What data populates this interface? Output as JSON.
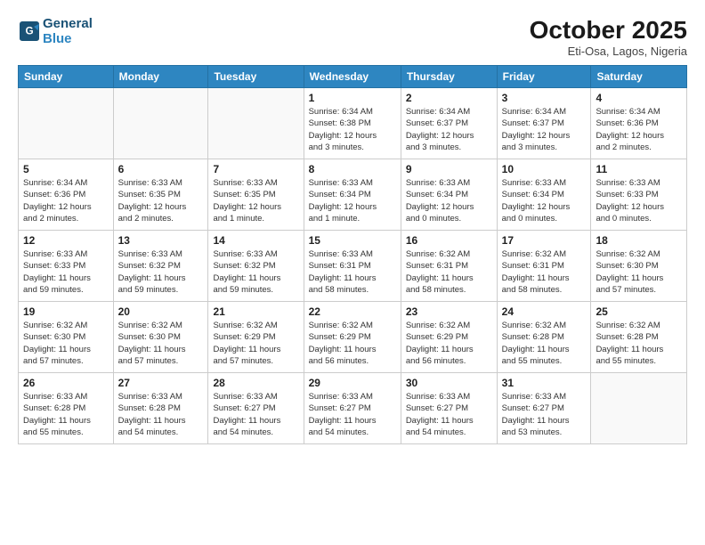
{
  "header": {
    "logo_line1": "General",
    "logo_line2": "Blue",
    "month": "October 2025",
    "location": "Eti-Osa, Lagos, Nigeria"
  },
  "weekdays": [
    "Sunday",
    "Monday",
    "Tuesday",
    "Wednesday",
    "Thursday",
    "Friday",
    "Saturday"
  ],
  "weeks": [
    [
      {
        "day": "",
        "info": ""
      },
      {
        "day": "",
        "info": ""
      },
      {
        "day": "",
        "info": ""
      },
      {
        "day": "1",
        "info": "Sunrise: 6:34 AM\nSunset: 6:38 PM\nDaylight: 12 hours\nand 3 minutes."
      },
      {
        "day": "2",
        "info": "Sunrise: 6:34 AM\nSunset: 6:37 PM\nDaylight: 12 hours\nand 3 minutes."
      },
      {
        "day": "3",
        "info": "Sunrise: 6:34 AM\nSunset: 6:37 PM\nDaylight: 12 hours\nand 3 minutes."
      },
      {
        "day": "4",
        "info": "Sunrise: 6:34 AM\nSunset: 6:36 PM\nDaylight: 12 hours\nand 2 minutes."
      }
    ],
    [
      {
        "day": "5",
        "info": "Sunrise: 6:34 AM\nSunset: 6:36 PM\nDaylight: 12 hours\nand 2 minutes."
      },
      {
        "day": "6",
        "info": "Sunrise: 6:33 AM\nSunset: 6:35 PM\nDaylight: 12 hours\nand 2 minutes."
      },
      {
        "day": "7",
        "info": "Sunrise: 6:33 AM\nSunset: 6:35 PM\nDaylight: 12 hours\nand 1 minute."
      },
      {
        "day": "8",
        "info": "Sunrise: 6:33 AM\nSunset: 6:34 PM\nDaylight: 12 hours\nand 1 minute."
      },
      {
        "day": "9",
        "info": "Sunrise: 6:33 AM\nSunset: 6:34 PM\nDaylight: 12 hours\nand 0 minutes."
      },
      {
        "day": "10",
        "info": "Sunrise: 6:33 AM\nSunset: 6:34 PM\nDaylight: 12 hours\nand 0 minutes."
      },
      {
        "day": "11",
        "info": "Sunrise: 6:33 AM\nSunset: 6:33 PM\nDaylight: 12 hours\nand 0 minutes."
      }
    ],
    [
      {
        "day": "12",
        "info": "Sunrise: 6:33 AM\nSunset: 6:33 PM\nDaylight: 11 hours\nand 59 minutes."
      },
      {
        "day": "13",
        "info": "Sunrise: 6:33 AM\nSunset: 6:32 PM\nDaylight: 11 hours\nand 59 minutes."
      },
      {
        "day": "14",
        "info": "Sunrise: 6:33 AM\nSunset: 6:32 PM\nDaylight: 11 hours\nand 59 minutes."
      },
      {
        "day": "15",
        "info": "Sunrise: 6:33 AM\nSunset: 6:31 PM\nDaylight: 11 hours\nand 58 minutes."
      },
      {
        "day": "16",
        "info": "Sunrise: 6:32 AM\nSunset: 6:31 PM\nDaylight: 11 hours\nand 58 minutes."
      },
      {
        "day": "17",
        "info": "Sunrise: 6:32 AM\nSunset: 6:31 PM\nDaylight: 11 hours\nand 58 minutes."
      },
      {
        "day": "18",
        "info": "Sunrise: 6:32 AM\nSunset: 6:30 PM\nDaylight: 11 hours\nand 57 minutes."
      }
    ],
    [
      {
        "day": "19",
        "info": "Sunrise: 6:32 AM\nSunset: 6:30 PM\nDaylight: 11 hours\nand 57 minutes."
      },
      {
        "day": "20",
        "info": "Sunrise: 6:32 AM\nSunset: 6:30 PM\nDaylight: 11 hours\nand 57 minutes."
      },
      {
        "day": "21",
        "info": "Sunrise: 6:32 AM\nSunset: 6:29 PM\nDaylight: 11 hours\nand 57 minutes."
      },
      {
        "day": "22",
        "info": "Sunrise: 6:32 AM\nSunset: 6:29 PM\nDaylight: 11 hours\nand 56 minutes."
      },
      {
        "day": "23",
        "info": "Sunrise: 6:32 AM\nSunset: 6:29 PM\nDaylight: 11 hours\nand 56 minutes."
      },
      {
        "day": "24",
        "info": "Sunrise: 6:32 AM\nSunset: 6:28 PM\nDaylight: 11 hours\nand 55 minutes."
      },
      {
        "day": "25",
        "info": "Sunrise: 6:32 AM\nSunset: 6:28 PM\nDaylight: 11 hours\nand 55 minutes."
      }
    ],
    [
      {
        "day": "26",
        "info": "Sunrise: 6:33 AM\nSunset: 6:28 PM\nDaylight: 11 hours\nand 55 minutes."
      },
      {
        "day": "27",
        "info": "Sunrise: 6:33 AM\nSunset: 6:28 PM\nDaylight: 11 hours\nand 54 minutes."
      },
      {
        "day": "28",
        "info": "Sunrise: 6:33 AM\nSunset: 6:27 PM\nDaylight: 11 hours\nand 54 minutes."
      },
      {
        "day": "29",
        "info": "Sunrise: 6:33 AM\nSunset: 6:27 PM\nDaylight: 11 hours\nand 54 minutes."
      },
      {
        "day": "30",
        "info": "Sunrise: 6:33 AM\nSunset: 6:27 PM\nDaylight: 11 hours\nand 54 minutes."
      },
      {
        "day": "31",
        "info": "Sunrise: 6:33 AM\nSunset: 6:27 PM\nDaylight: 11 hours\nand 53 minutes."
      },
      {
        "day": "",
        "info": ""
      }
    ]
  ]
}
